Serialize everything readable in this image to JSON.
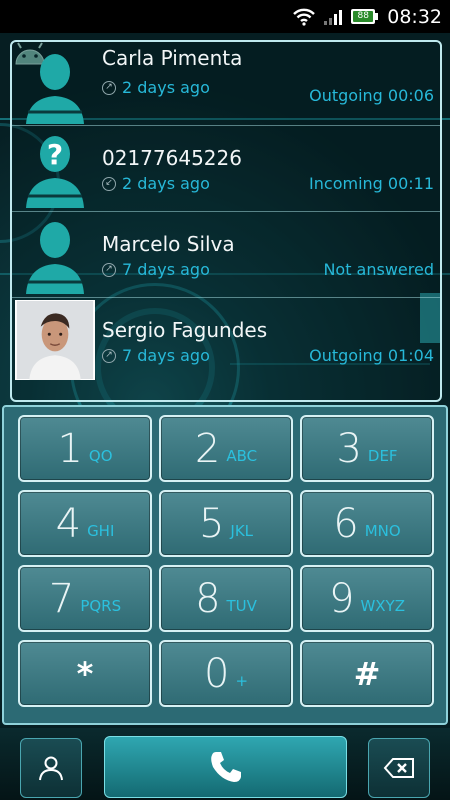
{
  "status_bar": {
    "time": "08:32",
    "battery_level": "88",
    "icons": [
      "wifi-icon",
      "signal-icon",
      "battery-icon"
    ]
  },
  "call_log": [
    {
      "name": "Carla Pimenta",
      "date": "2 days ago",
      "status": "Outgoing 00:06",
      "direction": "outgoing",
      "avatar": "android-silhouette"
    },
    {
      "name": "02177645226",
      "date": "2 days ago",
      "status": "Incoming 00:11",
      "direction": "incoming",
      "avatar": "unknown-question-silhouette"
    },
    {
      "name": "Marcelo Silva",
      "date": "7 days ago",
      "status": "Not answered",
      "direction": "outgoing",
      "avatar": "android-silhouette"
    },
    {
      "name": "Sergio Fagundes",
      "date": "7 days ago",
      "status": "Outgoing 01:04",
      "direction": "outgoing",
      "avatar": "contact-photo"
    }
  ],
  "keypad": {
    "keys": [
      {
        "digit": "1",
        "letters": "QO"
      },
      {
        "digit": "2",
        "letters": "ABC"
      },
      {
        "digit": "3",
        "letters": "DEF"
      },
      {
        "digit": "4",
        "letters": "GHI"
      },
      {
        "digit": "5",
        "letters": "JKL"
      },
      {
        "digit": "6",
        "letters": "MNO"
      },
      {
        "digit": "7",
        "letters": "PQRS"
      },
      {
        "digit": "8",
        "letters": "TUV"
      },
      {
        "digit": "9",
        "letters": "WXYZ"
      },
      {
        "digit": "*",
        "letters": ""
      },
      {
        "digit": "0",
        "letters": "+"
      },
      {
        "digit": "#",
        "letters": ""
      }
    ]
  },
  "bottom_bar": {
    "icons": [
      "person-icon",
      "phone-icon",
      "backspace-icon"
    ]
  },
  "colors": {
    "accent": "#27b8d8",
    "keypad_bg": "#2c6a74",
    "key_border": "#d6f1f4"
  }
}
